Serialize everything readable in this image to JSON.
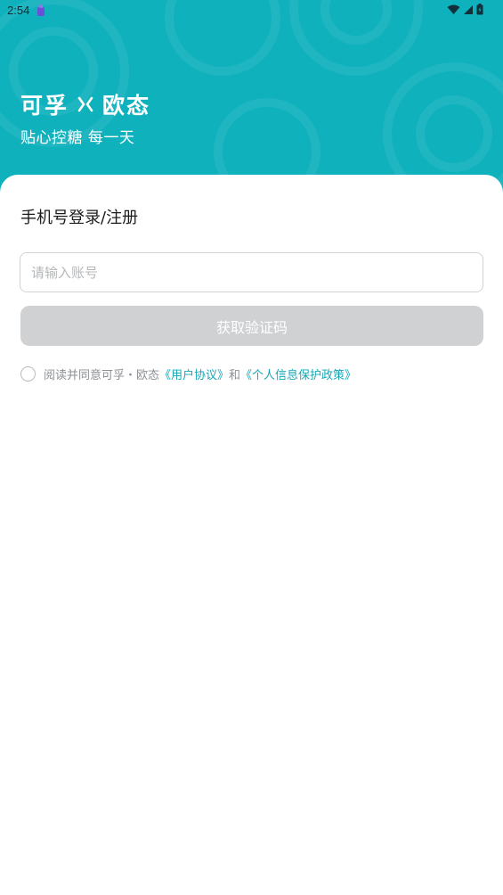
{
  "status_bar": {
    "time": "2:54",
    "icons": [
      "app-notification-icon",
      "wifi-icon",
      "cellular-signal-icon",
      "battery-icon"
    ]
  },
  "brand": {
    "name_left": "可孚",
    "name_right": "欧态",
    "slogan": "贴心控糖 每一天",
    "icons": [
      "cross-x-icon"
    ]
  },
  "login_form": {
    "title": "手机号登录/注册",
    "account_placeholder": "请输入账号",
    "account_value": "",
    "get_code_label": "获取验证码",
    "agreement": {
      "prefix": "阅读并同意可孚・欧态",
      "user_agreement": "《用户协议》",
      "conjunction": "和",
      "privacy_policy": "《个人信息保护政策》",
      "checked": false
    }
  },
  "colors": {
    "brand_teal": "#0fb1bd",
    "link": "#14a7b6",
    "button_disabled": "#d0d1d3",
    "text_muted": "#8c8f93"
  }
}
